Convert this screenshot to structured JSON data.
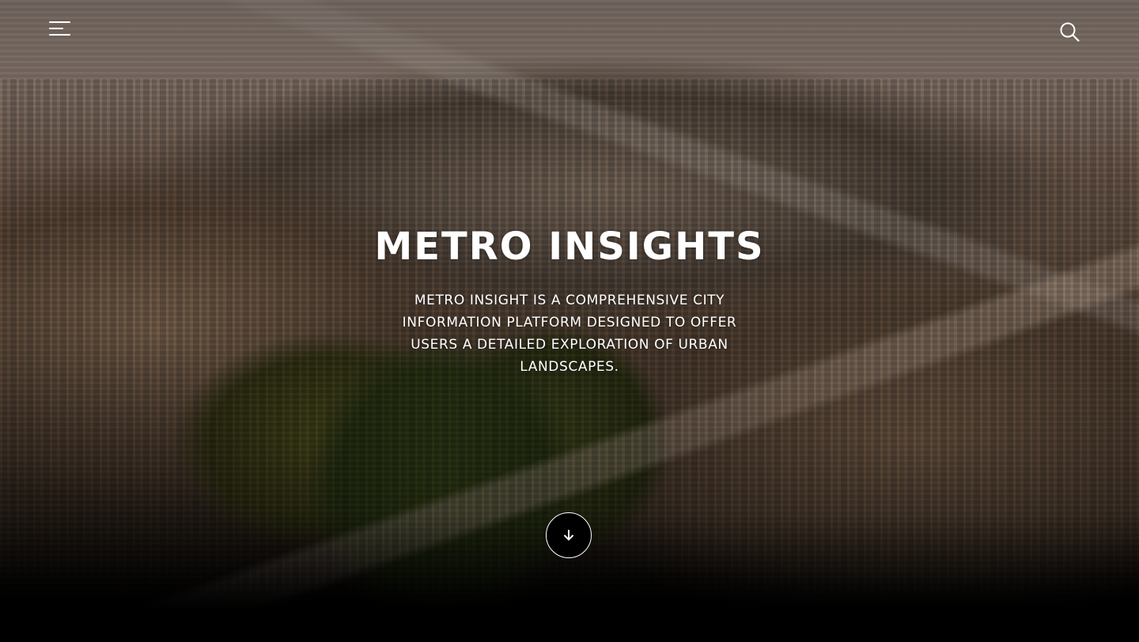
{
  "header": {
    "menu_icon": "hamburger-menu-icon",
    "search_icon": "search-icon"
  },
  "hero": {
    "title": "METRO INSIGHTS",
    "subtitle": "METRO INSIGHT IS A COMPREHENSIVE CITY INFORMATION PLATFORM DESIGNED TO OFFER USERS A DETAILED EXPLORATION OF URBAN LANDSCAPES.",
    "scroll_icon": "arrow-down-icon",
    "background": "aerial city skyline photo"
  },
  "colors": {
    "text": "#ffffff",
    "footer_band": "#000000"
  }
}
